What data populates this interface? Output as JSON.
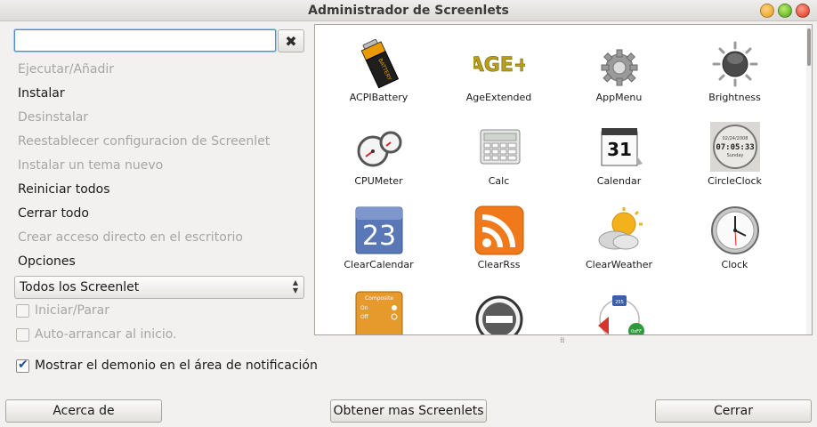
{
  "window": {
    "title": "Administrador de Screenlets"
  },
  "search": {
    "value": "",
    "placeholder": ""
  },
  "actions": [
    {
      "label": "Ejecutar/Añadir",
      "enabled": false
    },
    {
      "label": "Instalar",
      "enabled": true
    },
    {
      "label": "Desinstalar",
      "enabled": false
    },
    {
      "label": "Reestablecer configuracion de Screenlet",
      "enabled": false
    },
    {
      "label": "Instalar un tema nuevo",
      "enabled": false
    },
    {
      "label": "Reiniciar todos",
      "enabled": true
    },
    {
      "label": "Cerrar todo",
      "enabled": true
    },
    {
      "label": "Crear acceso directo en el escritorio",
      "enabled": false
    },
    {
      "label": "Opciones",
      "enabled": true
    }
  ],
  "filter": {
    "selected": "Todos los Screenlet"
  },
  "checkboxes": {
    "start_stop": {
      "label": "Iniciar/Parar",
      "checked": false,
      "enabled": false
    },
    "autostart": {
      "label": "Auto-arrancar al inicio.",
      "checked": false,
      "enabled": false
    },
    "tray": {
      "label": "Mostrar el demonio en el área de notificación",
      "checked": true,
      "enabled": true
    }
  },
  "screenlets": [
    {
      "name": "ACPIBattery",
      "icon": "battery-icon"
    },
    {
      "name": "AgeExtended",
      "icon": "age-logo-icon"
    },
    {
      "name": "AppMenu",
      "icon": "gear-icon"
    },
    {
      "name": "Brightness",
      "icon": "brightness-icon"
    },
    {
      "name": "CPUMeter",
      "icon": "gauge-icon"
    },
    {
      "name": "Calc",
      "icon": "calculator-icon"
    },
    {
      "name": "Calendar",
      "icon": "calendar-icon"
    },
    {
      "name": "CircleClock",
      "icon": "digital-clock-icon"
    },
    {
      "name": "ClearCalendar",
      "icon": "clear-calendar-icon"
    },
    {
      "name": "ClearRss",
      "icon": "rss-icon"
    },
    {
      "name": "ClearWeather",
      "icon": "weather-icon"
    },
    {
      "name": "Clock",
      "icon": "clock-icon"
    },
    {
      "name": "",
      "icon": "composite-icon"
    },
    {
      "name": "",
      "icon": "no-entry-icon"
    },
    {
      "name": "",
      "icon": "color-icon"
    },
    {
      "name": "",
      "icon": "teal-shape-icon"
    }
  ],
  "icon_text": {
    "battery": "BATTERY",
    "age": "AGE+",
    "calendar_day": "31",
    "clock_date": "02/24/2008",
    "clock_time": "07:05:33",
    "clock_day": "Sunday",
    "clear_calendar_day": "23",
    "composite_title": "Composite",
    "composite_on": "On",
    "composite_off": "Off",
    "color_a": "255",
    "color_b": "0xFF"
  },
  "buttons": {
    "about": "Acerca de",
    "get_more": "Obtener mas Screenlets",
    "close": "Cerrar"
  },
  "colors": {
    "accent": "#4e8bd4",
    "rss": "#f07a1b",
    "calendar_blue": "#5a78b8"
  }
}
